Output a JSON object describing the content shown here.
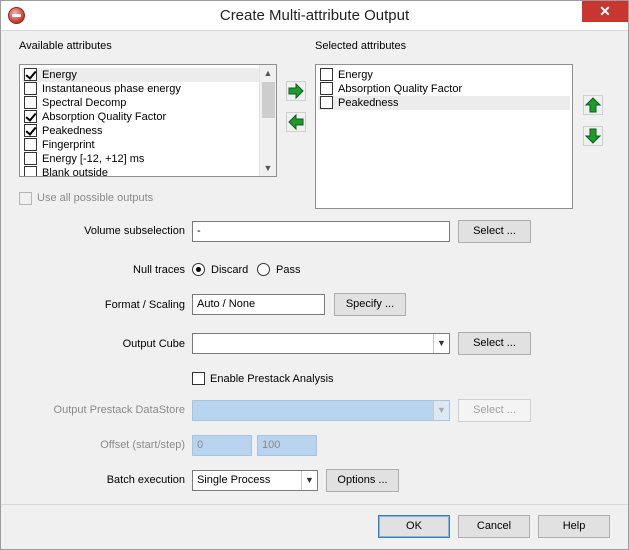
{
  "window": {
    "title": "Create Multi-attribute Output",
    "close_glyph": "✕"
  },
  "available": {
    "heading": "Available attributes",
    "items": [
      {
        "label": "Energy",
        "checked": true
      },
      {
        "label": "Instantaneous phase energy",
        "checked": false
      },
      {
        "label": "Spectral Decomp",
        "checked": false
      },
      {
        "label": "Absorption Quality Factor",
        "checked": true
      },
      {
        "label": "Peakedness",
        "checked": true
      },
      {
        "label": "Fingerprint",
        "checked": false
      },
      {
        "label": "Energy [-12, +12] ms",
        "checked": false
      },
      {
        "label": "Blank outside",
        "checked": false
      }
    ]
  },
  "selected": {
    "heading": "Selected attributes",
    "items": [
      {
        "label": "Energy",
        "checked": false
      },
      {
        "label": "Absorption Quality Factor",
        "checked": false
      },
      {
        "label": "Peakedness",
        "checked": false
      }
    ]
  },
  "use_all": {
    "label": "Use all possible outputs",
    "checked": false,
    "enabled": false
  },
  "volume": {
    "label": "Volume subselection",
    "value": "-",
    "button": "Select ..."
  },
  "null_traces": {
    "label": "Null traces",
    "options": [
      "Discard",
      "Pass"
    ],
    "selected": "Discard"
  },
  "format": {
    "label": "Format / Scaling",
    "value": "Auto / None",
    "button": "Specify ..."
  },
  "output_cube": {
    "label": "Output Cube",
    "value": "",
    "button": "Select ..."
  },
  "prestack": {
    "label": "Enable Prestack Analysis",
    "checked": false
  },
  "datastore": {
    "label": "Output Prestack DataStore",
    "value": "",
    "button": "Select ..."
  },
  "offset": {
    "label": "Offset (start/step)",
    "start": "0",
    "step": "100"
  },
  "batch": {
    "label": "Batch execution",
    "value": "Single Process",
    "button": "Options ..."
  },
  "footer": {
    "ok": "OK",
    "cancel": "Cancel",
    "help": "Help"
  },
  "colors": {
    "arrow_green": "#1f9a2e",
    "close_red": "#c7372f",
    "disabled_field": "#b9d4ee"
  }
}
